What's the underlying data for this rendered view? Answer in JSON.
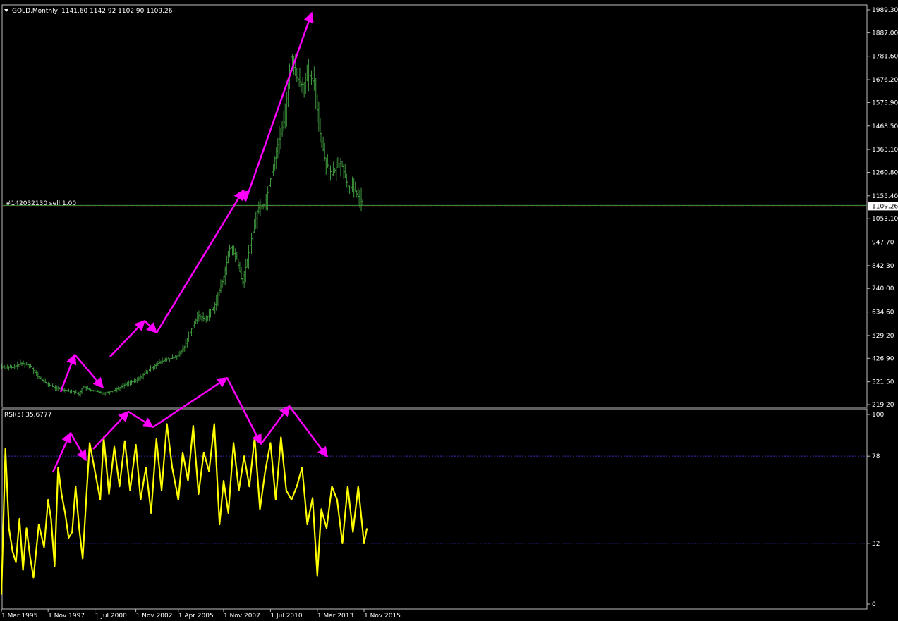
{
  "window": {
    "symbol_label": "GOLD,Monthly",
    "ohlc_label": "1141.60 1142.92 1102.90 1109.26"
  },
  "order_line": {
    "label": "#142032130 sell 1.00",
    "price": 1109.26,
    "current_price_label": "1109.26"
  },
  "colors": {
    "background": "#000000",
    "bars": "#3f9a3f",
    "rsi_line": "#ffff00",
    "annotation": "#ff00ff",
    "order_line": "#ff4000",
    "axis": "#c0c0c0",
    "level_lines": "#3a2bb0"
  },
  "price_axis": {
    "labels": [
      "1989.30",
      "1887.00",
      "1781.60",
      "1676.20",
      "1573.90",
      "1468.50",
      "1363.10",
      "1260.80",
      "1155.40",
      "1053.10",
      "947.70",
      "842.30",
      "740.00",
      "634.60",
      "529.20",
      "426.90",
      "321.50",
      "219.20"
    ],
    "values": [
      1989.3,
      1887.0,
      1781.6,
      1676.2,
      1573.9,
      1468.5,
      1363.1,
      1260.8,
      1155.4,
      1053.1,
      947.7,
      842.3,
      740.0,
      634.6,
      529.2,
      426.9,
      321.5,
      219.2
    ]
  },
  "rsi": {
    "header": "RSI(5) 35.6777",
    "axis_labels": [
      "100",
      "78",
      "32",
      "0"
    ],
    "axis_values": [
      100,
      78,
      32,
      0
    ],
    "levels": [
      78,
      32
    ]
  },
  "time_axis": {
    "labels": [
      "1 Mar 1995",
      "1 Nov 1997",
      "1 Jul 2000",
      "1 Nov 2002",
      "1 Apr 2005",
      "1 Nov 2007",
      "1 Jul 2010",
      "1 Mar 2013",
      "1 Nov 2015"
    ],
    "decimal_years": [
      1995.17,
      1997.83,
      2000.5,
      2002.83,
      2005.25,
      2007.83,
      2010.5,
      2013.17,
      2015.83
    ]
  },
  "chart_data": {
    "type": "line",
    "title": "GOLD,Monthly",
    "x_range": [
      1995.17,
      2016.5
    ],
    "price_ylim": [
      219.2,
      1989.3
    ],
    "rsi_ylim": [
      0,
      100
    ],
    "price_series": {
      "name": "GOLD,Monthly",
      "x": [
        1995.17,
        1995.8,
        1996.3,
        1996.8,
        1997.3,
        1997.83,
        1998.2,
        1998.7,
        1999.2,
        1999.6,
        1999.8,
        2000.2,
        2000.5,
        2001.0,
        2001.5,
        2002.0,
        2002.5,
        2002.83,
        2003.2,
        2003.6,
        2004.0,
        2004.5,
        2005.0,
        2005.25,
        2005.6,
        2006.0,
        2006.4,
        2006.8,
        2007.3,
        2007.83,
        2008.2,
        2008.6,
        2008.9,
        2009.3,
        2009.8,
        2010.2,
        2010.5,
        2010.9,
        2011.3,
        2011.7,
        2011.9,
        2012.3,
        2012.7,
        2013.0,
        2013.3,
        2013.6,
        2014.0,
        2014.5,
        2014.9,
        2015.3,
        2015.83
      ],
      "close": [
        390,
        385,
        405,
        395,
        340,
        310,
        295,
        285,
        280,
        265,
        300,
        285,
        280,
        270,
        280,
        300,
        320,
        325,
        350,
        375,
        400,
        420,
        430,
        440,
        480,
        560,
        620,
        600,
        660,
        790,
        930,
        870,
        760,
        920,
        1100,
        1120,
        1230,
        1380,
        1500,
        1800,
        1700,
        1650,
        1700,
        1660,
        1450,
        1320,
        1250,
        1310,
        1200,
        1180,
        1109
      ]
    },
    "rsi_series": {
      "name": "RSI(5)",
      "x": [
        1995.17,
        1995.4,
        1995.6,
        1995.8,
        1996.0,
        1996.2,
        1996.4,
        1996.6,
        1996.8,
        1997.0,
        1997.3,
        1997.6,
        1997.83,
        1998.0,
        1998.2,
        1998.4,
        1998.6,
        1998.8,
        1999.0,
        1999.2,
        1999.4,
        1999.6,
        1999.8,
        2000.0,
        2000.2,
        2000.5,
        2000.8,
        2001.0,
        2001.3,
        2001.6,
        2001.9,
        2002.2,
        2002.5,
        2002.83,
        2003.1,
        2003.4,
        2003.7,
        2004.0,
        2004.3,
        2004.6,
        2004.9,
        2005.25,
        2005.5,
        2005.8,
        2006.1,
        2006.4,
        2006.7,
        2007.0,
        2007.3,
        2007.6,
        2007.83,
        2008.1,
        2008.4,
        2008.7,
        2009.0,
        2009.3,
        2009.6,
        2009.9,
        2010.2,
        2010.5,
        2010.8,
        2011.1,
        2011.4,
        2011.7,
        2012.0,
        2012.3,
        2012.6,
        2012.9,
        2013.17,
        2013.4,
        2013.7,
        2014.0,
        2014.3,
        2014.6,
        2014.9,
        2015.2,
        2015.5,
        2015.83,
        2016.0
      ],
      "values": [
        5,
        82,
        40,
        28,
        22,
        45,
        18,
        40,
        25,
        14,
        42,
        30,
        55,
        45,
        20,
        72,
        58,
        48,
        35,
        38,
        62,
        40,
        24,
        55,
        85,
        70,
        55,
        88,
        58,
        83,
        62,
        86,
        60,
        84,
        55,
        72,
        48,
        87,
        60,
        95,
        72,
        55,
        80,
        65,
        94,
        58,
        80,
        70,
        95,
        42,
        65,
        48,
        85,
        60,
        78,
        62,
        88,
        50,
        70,
        85,
        55,
        88,
        60,
        55,
        62,
        72,
        42,
        56,
        15,
        50,
        40,
        62,
        55,
        32,
        62,
        38,
        62,
        32,
        40
      ]
    },
    "rsi_current": 35.6777
  }
}
